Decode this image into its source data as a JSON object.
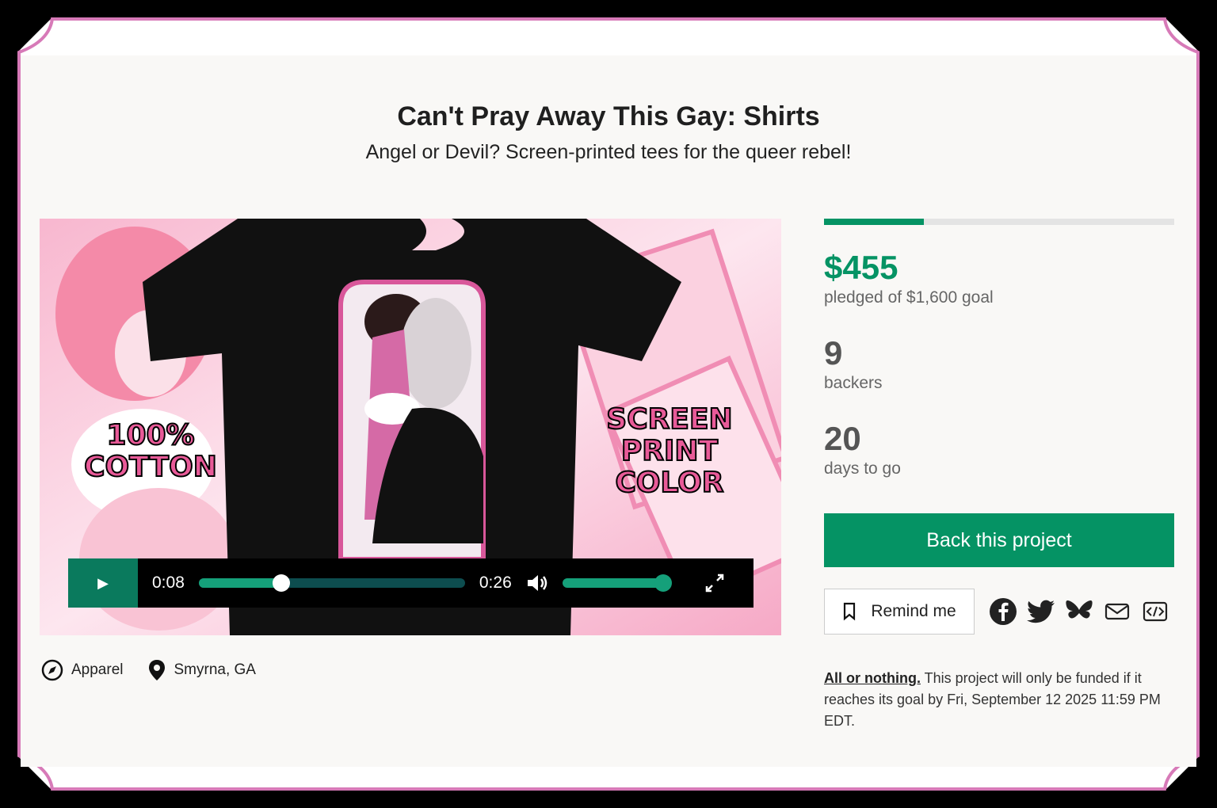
{
  "project": {
    "title": "Can't Pray Away This Gay: Shirts",
    "subtitle": "Angel or Devil? Screen-printed tees for the queer rebel!"
  },
  "media": {
    "left_text": [
      "100%",
      "COTTON"
    ],
    "right_text": [
      "SCREEN",
      "PRINT",
      "COLOR"
    ],
    "player": {
      "current_time": "0:08",
      "duration": "0:26",
      "progress_fraction": 0.31,
      "volume_fraction": 1.0
    }
  },
  "meta": {
    "category": "Apparel",
    "location": "Smyrna, GA"
  },
  "funding": {
    "progress_fraction": 0.284,
    "pledged": "$455",
    "pledged_label": "pledged of $1,600 goal",
    "backers": "9",
    "backers_label": "backers",
    "days": "20",
    "days_label": "days to go"
  },
  "buttons": {
    "back": "Back this project",
    "remind": "Remind me"
  },
  "share_icons": [
    "facebook-icon",
    "twitter-icon",
    "bluesky-icon",
    "email-icon",
    "embed-icon"
  ],
  "note": {
    "link": "All or nothing.",
    "text": " This project will only be funded if it reaches its goal by Fri, September 12 2025 11:59 PM EDT."
  },
  "colors": {
    "accent": "#059364",
    "frame": "#d77ab8"
  }
}
